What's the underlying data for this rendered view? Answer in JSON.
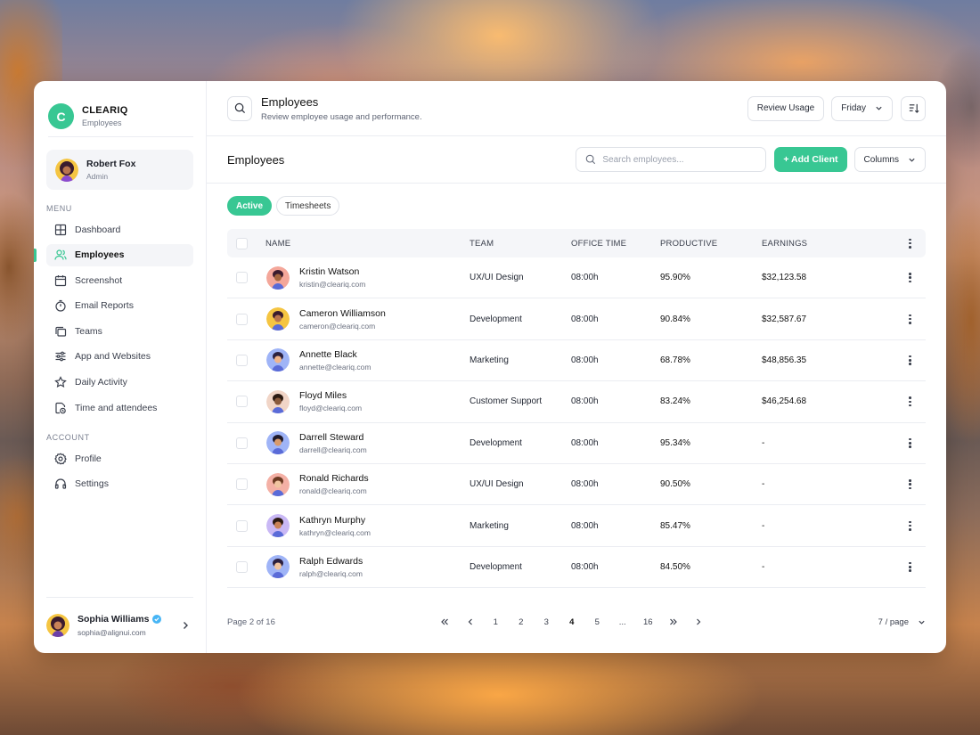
{
  "app": {
    "brand_initial": "C",
    "brand_name": "CLEARIQ",
    "brand_subtitle": "Employees",
    "accent": "#38c793"
  },
  "current_user": {
    "name": "Robert Fox",
    "role": "Admin"
  },
  "sidebar": {
    "menu_label": "MENU",
    "menu_items": [
      {
        "label": "Dashboard",
        "icon": "grid-icon"
      },
      {
        "label": "Employees",
        "icon": "users-icon",
        "active": true
      },
      {
        "label": "Screenshot",
        "icon": "calendar-icon"
      },
      {
        "label": "Email Reports",
        "icon": "timer-icon"
      },
      {
        "label": "Teams",
        "icon": "stack-icon"
      },
      {
        "label": "App and Websites",
        "icon": "sliders-icon"
      },
      {
        "label": "Daily Activity",
        "icon": "star-icon"
      },
      {
        "label": "Time and attendees",
        "icon": "file-clock-icon"
      }
    ],
    "account_label": "ACCOUNT",
    "account_items": [
      {
        "label": "Profile",
        "icon": "gear-icon"
      },
      {
        "label": "Settings",
        "icon": "headphones-icon"
      }
    ],
    "footer_user": {
      "name": "Sophia Williams",
      "email": "sophia@alignui.com",
      "verified": true
    }
  },
  "header": {
    "title": "Employees",
    "subtitle": "Review employee usage and performance.",
    "review_usage_label": "Review Usage",
    "day_select": "Friday"
  },
  "table_toolbar": {
    "title": "Employees",
    "search_placeholder": "Search employees...",
    "add_client_label": "+ Add Client",
    "columns_label": "Columns"
  },
  "filters": [
    {
      "label": "Active",
      "active": true
    },
    {
      "label": "Timesheets",
      "active": false
    }
  ],
  "table": {
    "columns": [
      "NAME",
      "TEAM",
      "OFFICE TIME",
      "PRODUCTIVE",
      "EARNINGS"
    ],
    "rows": [
      {
        "name": "Kristin Watson",
        "email": "kristin@cleariq.com",
        "team": "UX/UI Design",
        "office_time": "08:00h",
        "productive": "95.90%",
        "earnings": "$32,123.58"
      },
      {
        "name": "Cameron Williamson",
        "email": "cameron@cleariq.com",
        "team": "Development",
        "office_time": "08:00h",
        "productive": "90.84%",
        "earnings": "$32,587.67"
      },
      {
        "name": "Annette Black",
        "email": "annette@cleariq.com",
        "team": "Marketing",
        "office_time": "08:00h",
        "productive": "68.78%",
        "earnings": "$48,856.35"
      },
      {
        "name": "Floyd Miles",
        "email": "floyd@cleariq.com",
        "team": "Customer Support",
        "office_time": "08:00h",
        "productive": "83.24%",
        "earnings": "$46,254.68"
      },
      {
        "name": "Darrell Steward",
        "email": "darrell@cleariq.com",
        "team": "Development",
        "office_time": "08:00h",
        "productive": "95.34%",
        "earnings": "-"
      },
      {
        "name": "Ronald Richards",
        "email": "ronald@cleariq.com",
        "team": "UX/UI Design",
        "office_time": "08:00h",
        "productive": "90.50%",
        "earnings": "-"
      },
      {
        "name": "Kathryn Murphy",
        "email": "kathryn@cleariq.com",
        "team": "Marketing",
        "office_time": "08:00h",
        "productive": "85.47%",
        "earnings": "-"
      },
      {
        "name": "Ralph Edwards",
        "email": "ralph@cleariq.com",
        "team": "Development",
        "office_time": "08:00h",
        "productive": "84.50%",
        "earnings": "-"
      }
    ]
  },
  "pagination": {
    "info": "Page 2 of 16",
    "pages": [
      "1",
      "2",
      "3",
      "4",
      "5",
      "...",
      "16"
    ],
    "current_page": "4",
    "per_page": "7 / page"
  }
}
